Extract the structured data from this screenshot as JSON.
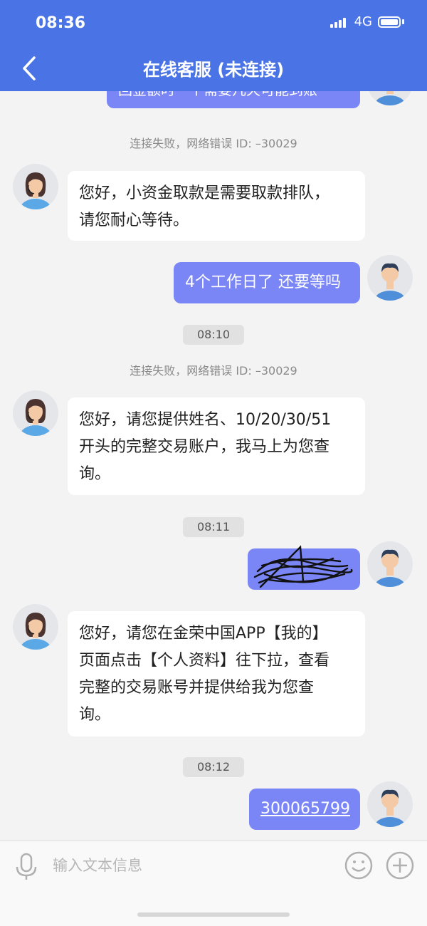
{
  "status": {
    "time": "08:36",
    "network": "4G"
  },
  "header": {
    "title": "在线客服 (未连接)"
  },
  "messages": [
    {
      "type": "user",
      "text": "回金额时一个需要几天可能到账"
    },
    {
      "type": "system",
      "text": "连接失败，网络错误 ID: –30029"
    },
    {
      "type": "agent",
      "lines": [
        "您好，小资金取款是需要取款排队，",
        "请您耐心等待。"
      ]
    },
    {
      "type": "user",
      "text": "4个工作日了 还要等吗"
    },
    {
      "type": "time",
      "text": "08:10"
    },
    {
      "type": "system",
      "text": "连接失败，网络错误 ID: –30029"
    },
    {
      "type": "agent",
      "lines": [
        "您好，请您提供姓名、10/20/30/51",
        "开头的完整交易账户，我马上为您查",
        "询。"
      ]
    },
    {
      "type": "time",
      "text": "08:11"
    },
    {
      "type": "user",
      "text": ""
    },
    {
      "type": "agent",
      "lines": [
        "您好，请您在金荣中国APP【我的】",
        "页面点击【个人资料】往下拉，查看",
        "完整的交易账号并提供给我为您查",
        "询。"
      ]
    },
    {
      "type": "time",
      "text": "08:12"
    },
    {
      "type": "user",
      "text": "300065799"
    }
  ],
  "input": {
    "placeholder": "输入文本信息"
  },
  "icons": [
    "back-icon",
    "microphone-icon",
    "emoji-icon",
    "plus-icon",
    "signal-icon",
    "battery-icon"
  ],
  "colors": {
    "header": "#4a73e6",
    "user_bubble": "#7b86f6",
    "agent_bubble": "#ffffff",
    "background": "#f3f3f3"
  }
}
